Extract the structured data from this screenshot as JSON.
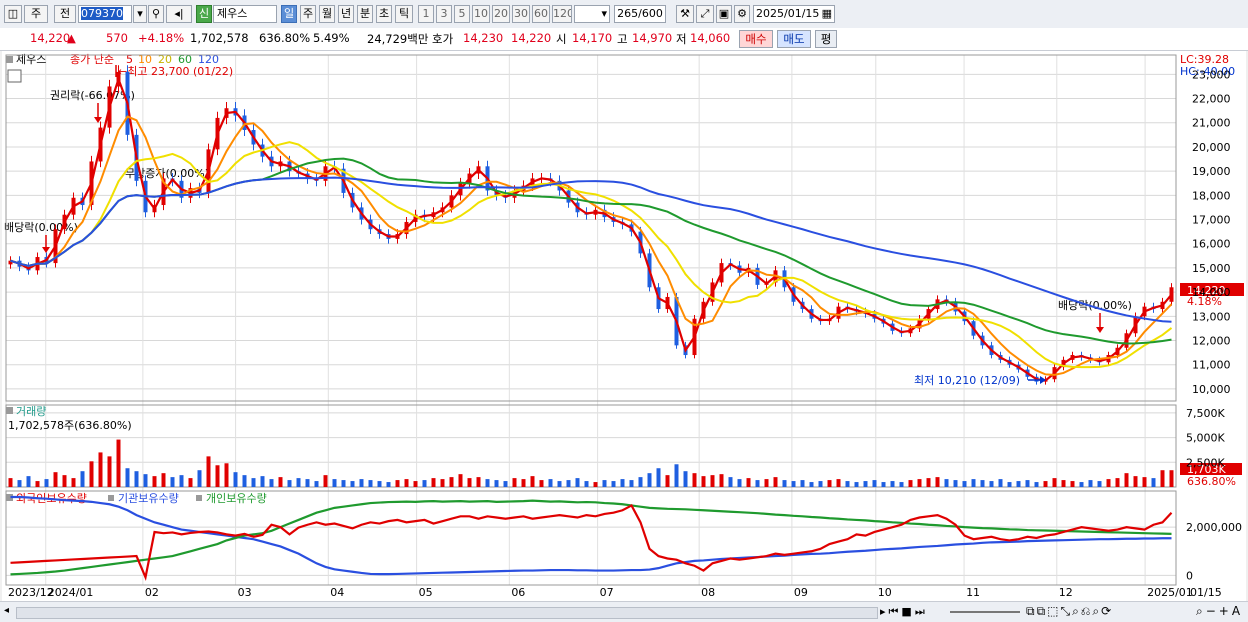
{
  "toolbar": {
    "type_label": "주",
    "market_label": "전",
    "code_value": "079370",
    "badge": "신",
    "name_value": "제우스",
    "periods": [
      "일",
      "주",
      "월",
      "년",
      "분",
      "초",
      "틱"
    ],
    "active_period": "일",
    "minute_options": [
      "1",
      "3",
      "5",
      "10",
      "20",
      "30",
      "60",
      "120"
    ],
    "count_value": "265",
    "count_total": "/600",
    "date_value": "2025/01/15"
  },
  "quote": {
    "price": "14,220",
    "change_arrow": "▲",
    "change": "570",
    "change_pct": "+4.18%",
    "volume": "1,702,578",
    "volume_pct": "636.80%",
    "turnover": "5.49%",
    "amount": "24,729백만",
    "ask_label": "호가",
    "bid_price": "14,230",
    "ask_price": "14,220",
    "open_label": "시",
    "open": "14,170",
    "high_label": "고",
    "high": "14,970",
    "low_label": "저",
    "low": "14,060",
    "buy_button": "매수",
    "sell_button": "매도",
    "eval_button": "평"
  },
  "chart_data": {
    "type": "line",
    "price_panel": {
      "legend_name": "제우스",
      "legend_series": "종가 단순",
      "ma_periods": [
        "5",
        "10",
        "20",
        "60",
        "120"
      ],
      "ma_colors": [
        "#e00000",
        "#ff8c00",
        "#f0e000",
        "#1f9a2e",
        "#2a4fe0"
      ],
      "lc_label": "LC:39.28",
      "hc_label": "HC:-40.00",
      "y_ticks": [
        "23,000",
        "22,000",
        "21,000",
        "20,000",
        "19,000",
        "18,000",
        "17,000",
        "16,000",
        "15,000",
        "14,000",
        "13,000",
        "12,000",
        "11,000",
        "10,000"
      ],
      "ylim": [
        9500,
        23800
      ],
      "current_price": "14,220",
      "current_pct": "4.18%",
      "annotations": [
        "←최고 23,700 (01/22)",
        "권리락(-66.07%)",
        "무상증자(0.00%)",
        "배당락(0.00%)",
        "배당락(0.00%)",
        "최저 10,210 (12/09)"
      ],
      "close": [
        15300,
        15050,
        14900,
        15450,
        15200,
        16600,
        17200,
        17900,
        17600,
        19400,
        20800,
        22500,
        23100,
        20500,
        18600,
        17300,
        17600,
        18700,
        18600,
        17900,
        18300,
        18100,
        19900,
        21200,
        21600,
        21300,
        20700,
        20100,
        19600,
        19200,
        19400,
        19000,
        18900,
        18700,
        18600,
        19200,
        19100,
        18100,
        17500,
        17000,
        16600,
        16400,
        16200,
        16400,
        16900,
        17200,
        17100,
        17300,
        17500,
        18000,
        18500,
        18900,
        19200,
        18200,
        18000,
        17900,
        18200,
        18400,
        18700,
        18700,
        18600,
        18200,
        17700,
        17300,
        17200,
        17400,
        17100,
        16900,
        16800,
        16500,
        15600,
        14200,
        13300,
        13800,
        11800,
        11400,
        12900,
        13600,
        14400,
        15200,
        15100,
        14800,
        15000,
        14300,
        14400,
        14900,
        14200,
        13600,
        13300,
        12900,
        12800,
        12900,
        13400,
        13300,
        13200,
        13100,
        12900,
        12700,
        12400,
        12300,
        12500,
        12900,
        13300,
        13700,
        13600,
        13200,
        12800,
        12200,
        11800,
        11400,
        11200,
        11000,
        10800,
        10500,
        10300,
        10400,
        10900,
        11200,
        11400,
        11300,
        11200,
        11100,
        11400,
        11700,
        12300,
        13000,
        13400,
        13300,
        13600,
        14200
      ]
    },
    "volume_panel": {
      "title": "거래량",
      "readout": "1,702,578주(636.80%)",
      "y_ticks": [
        "7,500K",
        "5,000K",
        "2,500K"
      ],
      "current": "1,703K",
      "current_pct": "636.80%",
      "values": [
        0.9,
        0.7,
        1.1,
        0.6,
        0.8,
        1.5,
        1.2,
        0.9,
        1.6,
        2.6,
        3.5,
        3.1,
        4.8,
        1.9,
        1.6,
        1.3,
        1.1,
        1.4,
        1.0,
        1.2,
        0.9,
        1.7,
        3.1,
        2.2,
        2.4,
        1.5,
        1.2,
        0.9,
        1.1,
        0.8,
        1.0,
        0.7,
        0.9,
        0.8,
        0.6,
        1.2,
        0.8,
        0.7,
        0.6,
        0.8,
        0.7,
        0.6,
        0.5,
        0.7,
        0.8,
        0.6,
        0.7,
        0.9,
        0.8,
        1.0,
        1.3,
        0.9,
        1.0,
        0.8,
        0.7,
        0.6,
        0.9,
        0.8,
        1.1,
        0.7,
        0.8,
        0.6,
        0.7,
        0.9,
        0.6,
        0.5,
        0.7,
        0.6,
        0.8,
        0.7,
        1.0,
        1.4,
        1.9,
        1.2,
        2.3,
        1.6,
        1.4,
        1.1,
        1.2,
        1.3,
        1.0,
        0.8,
        0.9,
        0.7,
        0.8,
        1.0,
        0.7,
        0.6,
        0.7,
        0.5,
        0.6,
        0.7,
        0.8,
        0.6,
        0.5,
        0.6,
        0.7,
        0.5,
        0.6,
        0.5,
        0.7,
        0.8,
        0.9,
        1.0,
        0.8,
        0.7,
        0.6,
        0.8,
        0.7,
        0.6,
        0.8,
        0.5,
        0.6,
        0.7,
        0.5,
        0.6,
        0.9,
        0.7,
        0.6,
        0.5,
        0.7,
        0.6,
        0.8,
        0.9,
        1.4,
        1.1,
        1.0,
        0.9,
        1.7,
        1.7
      ]
    },
    "holdings_panel": {
      "series_names": [
        "외국인보유수량",
        "기관보유수량",
        "개인보유수량"
      ],
      "series_colors": [
        "#e00000",
        "#2a4fe0",
        "#1f9a2e"
      ],
      "y_ticks": [
        "2,000,000",
        "0"
      ],
      "foreign": [
        520000,
        540000,
        560000,
        580000,
        600000,
        620000,
        640000,
        660000,
        680000,
        700000,
        720000,
        740000,
        760000,
        780000,
        800000,
        -80000,
        1800000,
        1750000,
        1780000,
        1700000,
        1760000,
        1800000,
        1820000,
        1780000,
        1700000,
        1650000,
        1720000,
        1600000,
        1680000,
        2100000,
        2000000,
        1700000,
        1980000,
        2100000,
        2200000,
        2100000,
        2150000,
        2050000,
        1950000,
        2100000,
        2200000,
        2150000,
        2250000,
        2300000,
        2200000,
        2250000,
        2300000,
        2150000,
        2250000,
        2350000,
        2450000,
        2450000,
        2350000,
        2450000,
        2400000,
        2350000,
        2400000,
        2450000,
        2350000,
        2400000,
        2450000,
        2500000,
        2450000,
        2400000,
        2500000,
        2450000,
        2550000,
        2600000,
        2700000,
        2900000,
        2200000,
        1100000,
        800000,
        700000,
        650000,
        500000,
        400000,
        200000,
        500000,
        600000,
        700000,
        650000,
        700000,
        750000,
        800000,
        900000,
        850000,
        900000,
        950000,
        1000000,
        1100000,
        1300000,
        1400000,
        1500000,
        1700000,
        1650000,
        1800000,
        1900000,
        2000000,
        2100000,
        2300000,
        2400000,
        2450000,
        2500000,
        2350000,
        2100000,
        1650000,
        1500000,
        1550000,
        1600000,
        1500000,
        1450000,
        1500000,
        1600000,
        1550000,
        1650000,
        1700000,
        1800000,
        1900000,
        2000000,
        1950000,
        1900000,
        1850000,
        1900000,
        2000000,
        1950000,
        1900000,
        2100000,
        2200000,
        2600000
      ],
      "institution": [
        3250000,
        3250000,
        3230000,
        3200000,
        3180000,
        3150000,
        3120000,
        3100000,
        3080000,
        3050000,
        3000000,
        2950000,
        2850000,
        2700000,
        2500000,
        2350000,
        2200000,
        2100000,
        2000000,
        1900000,
        1850000,
        1800000,
        1750000,
        1700000,
        1650000,
        1600000,
        1550000,
        1500000,
        1400000,
        1300000,
        1200000,
        1050000,
        900000,
        700000,
        500000,
        350000,
        250000,
        200000,
        150000,
        100000,
        60000,
        50000,
        50000,
        60000,
        70000,
        80000,
        90000,
        100000,
        110000,
        120000,
        130000,
        140000,
        150000,
        160000,
        170000,
        180000,
        190000,
        200000,
        200000,
        210000,
        220000,
        220000,
        220000,
        210000,
        210000,
        200000,
        200000,
        200000,
        210000,
        220000,
        220000,
        240000,
        300000,
        400000,
        500000,
        550000,
        600000,
        620000,
        650000,
        680000,
        700000,
        720000,
        740000,
        760000,
        780000,
        800000,
        820000,
        850000,
        870000,
        890000,
        900000,
        920000,
        950000,
        980000,
        1000000,
        1020000,
        1050000,
        1080000,
        1100000,
        1120000,
        1150000,
        1180000,
        1200000,
        1220000,
        1250000,
        1280000,
        1300000,
        1320000,
        1350000,
        1370000,
        1380000,
        1390000,
        1400000,
        1420000,
        1430000,
        1440000,
        1450000,
        1460000,
        1470000,
        1480000,
        1490000,
        1500000,
        1500000,
        1510000,
        1520000,
        1520000,
        1530000,
        1530000,
        1540000,
        1540000
      ],
      "individual": [
        40000,
        60000,
        80000,
        100000,
        130000,
        160000,
        200000,
        250000,
        300000,
        350000,
        400000,
        450000,
        500000,
        550000,
        600000,
        650000,
        700000,
        750000,
        800000,
        900000,
        1000000,
        1100000,
        1200000,
        1300000,
        1450000,
        1550000,
        1650000,
        1700000,
        1750000,
        1850000,
        2000000,
        2150000,
        2300000,
        2450000,
        2600000,
        2700000,
        2800000,
        2850000,
        2900000,
        2950000,
        3000000,
        3020000,
        3040000,
        3050000,
        3060000,
        3050000,
        3070000,
        3080000,
        3060000,
        3070000,
        3080000,
        3060000,
        3070000,
        3080000,
        3050000,
        3060000,
        3070000,
        3080000,
        3100000,
        3080000,
        3060000,
        3070000,
        3050000,
        3030000,
        3040000,
        3030000,
        3000000,
        2980000,
        2950000,
        2900000,
        2850000,
        2800000,
        2780000,
        2760000,
        2750000,
        2740000,
        2720000,
        2700000,
        2680000,
        2660000,
        2640000,
        2620000,
        2600000,
        2580000,
        2550000,
        2520000,
        2500000,
        2470000,
        2450000,
        2420000,
        2400000,
        2370000,
        2350000,
        2320000,
        2300000,
        2280000,
        2250000,
        2230000,
        2200000,
        2180000,
        2150000,
        2130000,
        2100000,
        2080000,
        2050000,
        2030000,
        2000000,
        1980000,
        1960000,
        1950000,
        1930000,
        1910000,
        1900000,
        1880000,
        1870000,
        1860000,
        1850000,
        1840000,
        1830000,
        1820000,
        1810000,
        1800000,
        1790000,
        1780000,
        1770000,
        1760000,
        1750000,
        1740000,
        1730000,
        1720000
      ]
    },
    "x_labels": [
      "2023/12",
      "2024/01",
      "02",
      "03",
      "04",
      "05",
      "06",
      "07",
      "08",
      "09",
      "10",
      "11",
      "12",
      "2025/01",
      "01/15"
    ]
  }
}
